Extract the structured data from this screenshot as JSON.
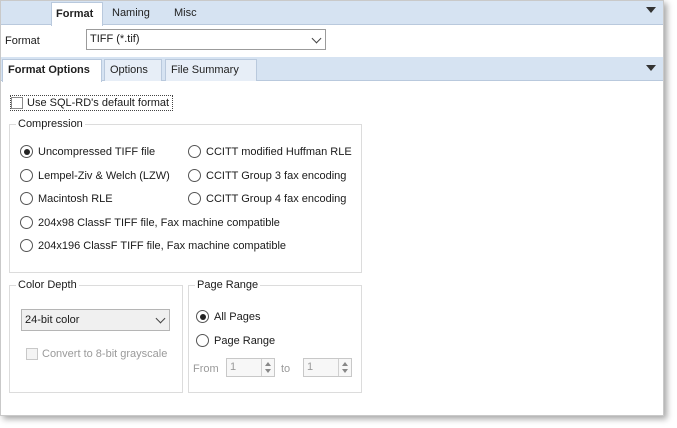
{
  "top_tabs": [
    "Format",
    "Naming",
    "Misc"
  ],
  "format_row": {
    "label": "Format",
    "value": "TIFF (*.tif)"
  },
  "sub_tabs": [
    "Format Options",
    "Options",
    "File Summary"
  ],
  "default_format_checkbox": {
    "label": "Use SQL-RD's default format",
    "checked": false
  },
  "compression": {
    "title": "Compression",
    "options": [
      {
        "label": "Uncompressed TIFF file",
        "selected": true
      },
      {
        "label": "CCITT modified Huffman RLE",
        "selected": false
      },
      {
        "label": "Lempel-Ziv & Welch (LZW)",
        "selected": false
      },
      {
        "label": "CCITT Group 3 fax encoding",
        "selected": false
      },
      {
        "label": "Macintosh RLE",
        "selected": false
      },
      {
        "label": "CCITT Group 4 fax encoding",
        "selected": false
      },
      {
        "label": "204x98 ClassF TIFF file, Fax machine compatible",
        "selected": false
      },
      {
        "label": "204x196 ClassF TIFF file, Fax machine compatible",
        "selected": false
      }
    ]
  },
  "color_depth": {
    "title": "Color Depth",
    "value": "24-bit color",
    "grayscale_label": "Convert to 8-bit grayscale",
    "grayscale_enabled": false
  },
  "page_range": {
    "title": "Page Range",
    "all_pages_label": "All Pages",
    "page_range_label": "Page Range",
    "selected": "All Pages",
    "from_label": "From",
    "from_value": "1",
    "to_label": "to",
    "to_value": "1"
  }
}
